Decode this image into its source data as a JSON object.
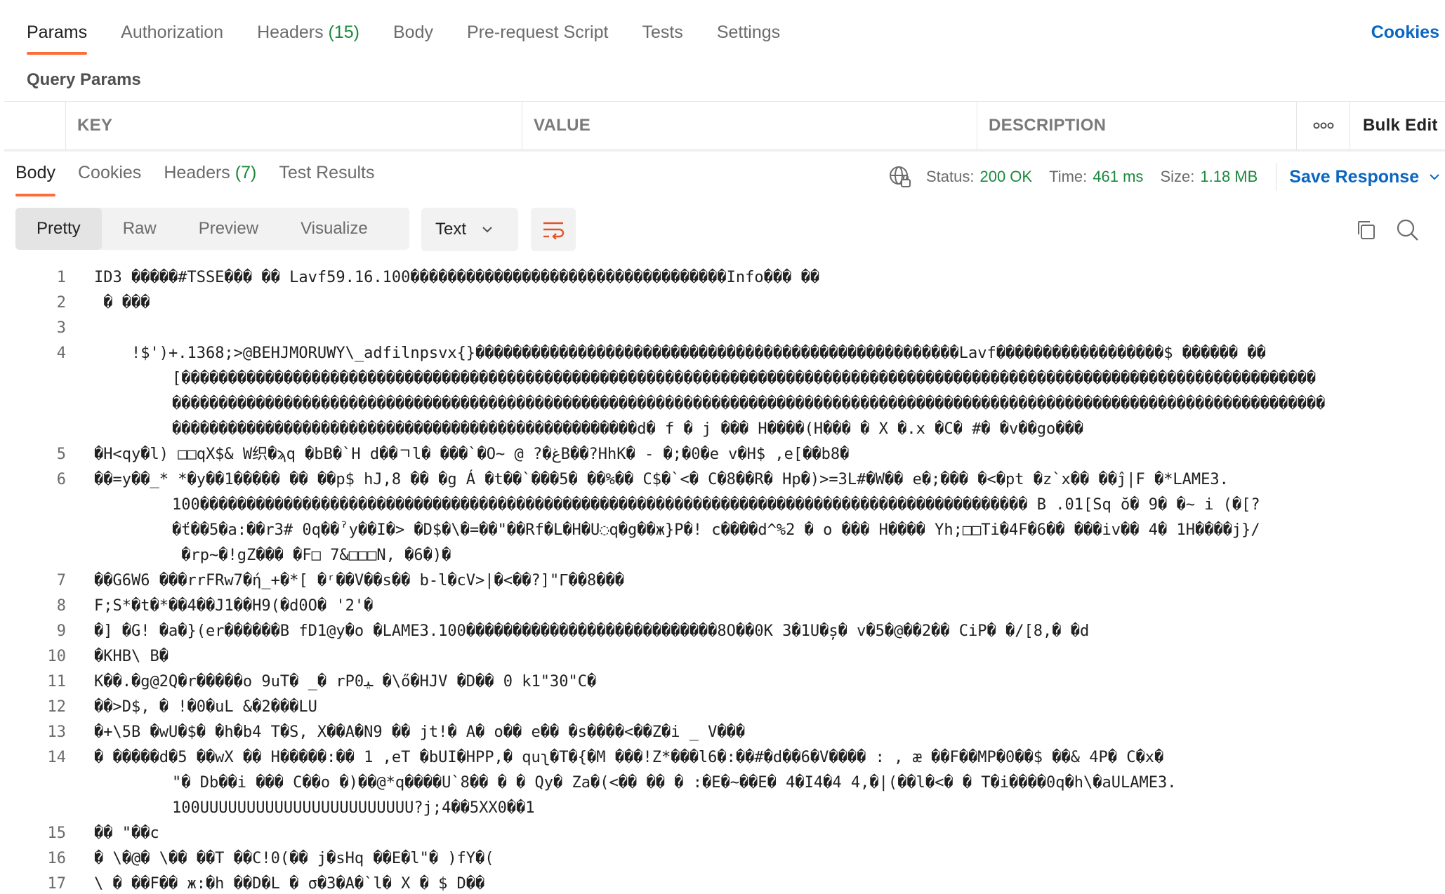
{
  "request_tabs": {
    "params": "Params",
    "authorization": "Authorization",
    "headers_label": "Headers",
    "headers_count": "(15)",
    "body": "Body",
    "prerequest": "Pre-request Script",
    "tests": "Tests",
    "settings": "Settings",
    "cookies": "Cookies"
  },
  "query_params": {
    "title": "Query Params",
    "col_key": "KEY",
    "col_value": "VALUE",
    "col_description": "DESCRIPTION",
    "more": "ooo",
    "bulk_edit": "Bulk Edit"
  },
  "response_tabs": {
    "body": "Body",
    "cookies": "Cookies",
    "headers_label": "Headers",
    "headers_count": "(7)",
    "test_results": "Test Results"
  },
  "status": {
    "status_label": "Status:",
    "status_value": "200 OK",
    "time_label": "Time:",
    "time_value": "461 ms",
    "size_label": "Size:",
    "size_value": "1.18 MB",
    "save_response": "Save Response",
    "green": "#1a8a3c",
    "link_blue": "#0a66c2",
    "accent_orange": "#ff6c37"
  },
  "view": {
    "pretty": "Pretty",
    "raw": "Raw",
    "preview": "Preview",
    "visualize": "Visualize",
    "format": "Text",
    "icons": [
      "wrap-lines-icon",
      "copy-icon",
      "search-icon"
    ]
  },
  "code_lines": [
    {
      "n": "1",
      "t": "ID3 �����#TSSE��� �� Lavf59.16.100����������������������������������Info��� ��"
    },
    {
      "n": "2",
      "t": " � ���"
    },
    {
      "n": "3",
      "t": ""
    },
    {
      "n": "4",
      "t": "    !$')+.1368;>@BEHJMORUWY\\_adfilnpsvx{}����������������������������������������������������Lavf������������������$ ������ ��\n    [��������������������������������������������������������������������������������������������������������������������������\n    ����������������������������������������������������������������������������������������������������������������������������\n    ��������������������������������������������������d� f � j ��� H����(H��� � X �.x �C� #� �v��go���"
    },
    {
      "n": "5",
      "t": "�H<qy�l) □□qX$& W织�ϡq �bB�`H d��ㄱl� ���`�O~ @ ?�ﻍB��?HhK� - �;�0�e v�H$ ,e[��b8�"
    },
    {
      "n": "6",
      "t": "��=y��_* *�y��1����� �� ��p$ hJ,8 �� �g Á �t��`���5� ��%�� C$�`<� C�8��R� Hp�)>=3L#�W�� e�;��� �<�pt �z`x�� ��ĵ|F �*LAME3.\n    100����������������������������������������������������������������������������������������� B .01[Sq ŏ� 9� �~ i (�[?\n    �ť��5�a:��r3# 0q��ˀy��I�> �D$�\\�=��\"��Rf�L�H�U◌q�g��ж}P�! c����d^%2 � o ��� H���� Yh;□□Ti�4F�6�� ���iv�� 4� 1H����j}/\n     �rp~�!gZ��� �F□ 7&□□□N, �6�)�"
    },
    {
      "n": "7",
      "t": "��G6W6 ���rrFRw7�ή_+�*[ �ʳ��V��s�� b-l�cV>|�<��?]\"Γ��8���"
    },
    {
      "n": "8",
      "t": "F;S*�t�*��4��J1��H9(�d0O� '2'�"
    },
    {
      "n": "9",
      "t": "�] �G! �a�}(er������B fD1@y�o �LAME3.100���������������������������8O��0K 3�1U�ș� v�5�@��2�� CiP� �/[8,� �d"
    },
    {
      "n": "10",
      "t": "�KHB\\ B�"
    },
    {
      "n": "11",
      "t": "K��.�g@2Q�r�����o 9uT� _� rP0ﯿ �\\ő�HJV �D�� 0 k1\"30\"C�"
    },
    {
      "n": "12",
      "t": "��>D$, � !�0�uL &�2���LU"
    },
    {
      "n": "13",
      "t": "�+\\5B �wU�$� �h�b4 T�S, X��A�N9 �� jt!� A� o�� e�� �s����<��Z�i _ V���"
    },
    {
      "n": "14",
      "t": "� �����d�5 ��wX �� H�����:�� 1 ,eT �bUI�HPP,� quʅ�T�{�M ���!Z*���l6�:��#�d��6�V���� : , æ ��F��MP�0��$ ��& 4P� C�x�\n    \"� Db��i ��� C��o �)��@*q����U`8�� � � Qy� Za�(<�� �� � :�E�~��E� 4�I4�4 4,�|(��l�<� � T�i����0q�h\\�aULAME3.\n    100UUUUUUUUUUUUUUUUUUUUUUU?j;4��5XX0��1"
    },
    {
      "n": "15",
      "t": "�� \"��c"
    },
    {
      "n": "16",
      "t": "� \\�@� \\�� ��T ��C!0(�� j�sHq ��E�l\"� )fY�("
    },
    {
      "n": "17",
      "t": "\\ � ��F�� ж:�h ��D�L � σ�3�A�`l� X � $ D��"
    }
  ]
}
